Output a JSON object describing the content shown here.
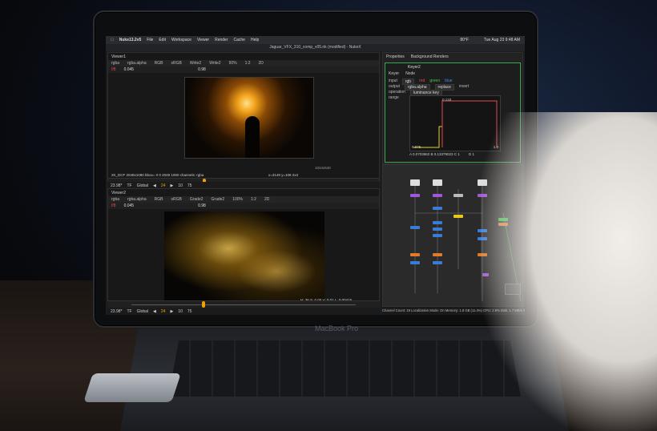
{
  "device": {
    "brand_label": "MacBook Pro"
  },
  "menubar": {
    "app": "Nuke13.2v5",
    "items": [
      "File",
      "Edit",
      "Workspace",
      "Viewer",
      "Render",
      "Cache",
      "Help"
    ],
    "temperature": "80°F",
    "clock": "Tue Aug 23  9:48 AM"
  },
  "window": {
    "title": "Jaguar_VFX_310_comp_v05.nk (modified) - NukeX"
  },
  "viewer_top": {
    "tab": "Viewer1",
    "channels": "rgba",
    "layer": "rgba.alpha",
    "mode": "RGB",
    "colorspace": "sRGB",
    "input_a": "Write2",
    "input_b": "Write2",
    "zoom": "50%",
    "ratio": "1:2",
    "view": "2D",
    "fstop": "f/8",
    "gain": "0.045",
    "gamma": "0.98",
    "corner_label": "1024x540",
    "info": "2K_DCF 2048x1080  bbox= 0 0 2048 1080 channels: rgba",
    "coords": "x=3148 y=108 2x3"
  },
  "timeline_top": {
    "fps": "23.98*",
    "tf": "TF",
    "scope": "Global",
    "frame": "24",
    "end": "75",
    "step": "10"
  },
  "viewer_bottom": {
    "tab": "Viewer2",
    "channels": "rgba",
    "layer": "rgba.alpha",
    "mode": "RGB",
    "colorspace": "sRGB",
    "input_a": "Grade2",
    "input_b": "Grade2",
    "zoom": "100%",
    "ratio": "1:2",
    "view": "2D",
    "fstop": "f/8",
    "gain": "0.045",
    "gamma": "0.98",
    "info": "HD_1080 1920x1080  bbox= 358 310 1522 742 channels: rgba",
    "coords": "x=1930 y=562 2x3",
    "pixel_values": "0.00452  0.00000  0.00000",
    "hsvl": "H: 36 S: 0.00 V: 0.01 L: 0.00415"
  },
  "timeline_bottom": {
    "fps": "23.98*",
    "tf": "TF",
    "scope": "Global",
    "frame": "24",
    "end": "75",
    "step": "10"
  },
  "properties": {
    "tabs": [
      "Properties",
      "Background Renders"
    ],
    "node_title": "Keyer2",
    "subtabs": [
      "Keyer",
      "Node"
    ],
    "input_label": "input",
    "input_value": "rgb",
    "output_label": "output",
    "output_value": "rgba.alpha",
    "operation_label": "operation",
    "operation_value": "luminance key",
    "range_label": "range",
    "checkboxes": [
      "red",
      "green",
      "blue"
    ],
    "replace": "replace",
    "invert": "invert",
    "graph_label_a": "0.03",
    "graph_label_b": "0.075",
    "graph_label_c": "0.133",
    "graph_label_d": "1.0",
    "readout": "A 0.0703862  B 0.13379023  C 1",
    "readout_d": "D 1"
  },
  "status": {
    "text": "Channel Count: 19  Localization Mode: On  Memory: 1.8 GB (11.4%)  CPU: 2.8%  Disk: 1.7 MB/s  Network: 0.00 MB/s"
  },
  "colors": {
    "node_yellow": "#e8c81a",
    "node_blue": "#3a7bd5",
    "node_orange": "#e07a2a",
    "node_green": "#2fbf3a",
    "node_purple": "#a057d8",
    "keyer_frame": "#3aa650"
  }
}
